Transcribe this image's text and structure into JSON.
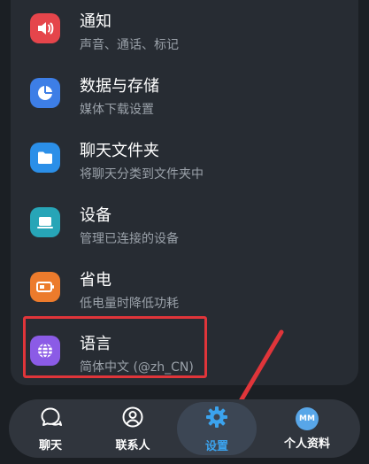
{
  "settings": {
    "items": [
      {
        "title": "通知",
        "subtitle": "声音、通话、标记",
        "icon": "speaker-icon",
        "color": "#e5454b"
      },
      {
        "title": "数据与存储",
        "subtitle": "媒体下载设置",
        "icon": "pie-chart-icon",
        "color": "#3d7ee6"
      },
      {
        "title": "聊天文件夹",
        "subtitle": "将聊天分类到文件夹中",
        "icon": "folder-icon",
        "color": "#2b8fe8"
      },
      {
        "title": "设备",
        "subtitle": "管理已连接的设备",
        "icon": "laptop-icon",
        "color": "#27a5b7"
      },
      {
        "title": "省电",
        "subtitle": "低电量时降低功耗",
        "icon": "battery-icon",
        "color": "#ec7b2c"
      },
      {
        "title": "语言",
        "subtitle": "简体中文 (@zh_CN)",
        "icon": "globe-icon",
        "color": "#8b5be6"
      }
    ]
  },
  "nav": {
    "items": [
      {
        "label": "聊天",
        "icon": "chat-icon"
      },
      {
        "label": "联系人",
        "icon": "contacts-icon"
      },
      {
        "label": "设置",
        "icon": "gear-icon",
        "active": true
      },
      {
        "label": "个人资料",
        "icon": "avatar",
        "avatar_text": "MM"
      }
    ]
  },
  "colors": {
    "background": "#1b1f24",
    "card": "#272c33",
    "nav_bar": "#30353d",
    "accent": "#3ba3ee",
    "highlight_annotation": "#e0353a"
  }
}
